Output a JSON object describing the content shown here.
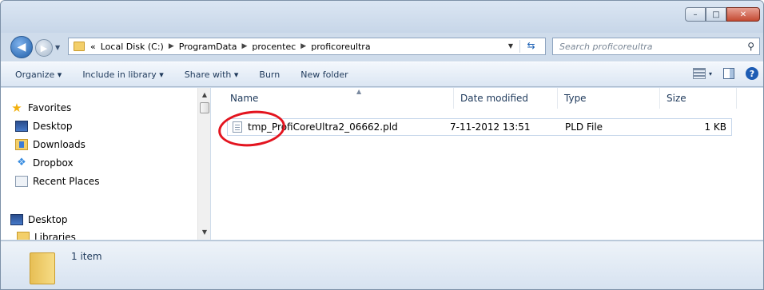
{
  "window": {
    "controls": {
      "minimize": "–",
      "maximize": "□",
      "close": "✕"
    }
  },
  "address": {
    "breadcrumb": [
      "«",
      "Local Disk (C:)",
      "ProgramData",
      "procentec",
      "proficoreultra"
    ],
    "search_placeholder": "Search proficoreultra"
  },
  "toolbar": {
    "organize": "Organize ▾",
    "include_in_library": "Include in library ▾",
    "share_with": "Share with ▾",
    "burn": "Burn",
    "new_folder": "New folder",
    "views": "▾"
  },
  "sidebar": {
    "items": [
      {
        "label": "Favorites",
        "icon": "star-icon"
      },
      {
        "label": "Desktop",
        "icon": "desktop-icon"
      },
      {
        "label": "Downloads",
        "icon": "downloads-icon"
      },
      {
        "label": "Dropbox",
        "icon": "dropbox-icon"
      },
      {
        "label": "Recent Places",
        "icon": "recent-places-icon"
      },
      {
        "label": "Desktop",
        "icon": "desktop-icon"
      },
      {
        "label": "Libraries",
        "icon": "libraries-icon"
      }
    ]
  },
  "columns": [
    "Name",
    "Date modified",
    "Type",
    "Size"
  ],
  "files": [
    {
      "name": "tmp_ProfiCoreUltra2_06662.pld",
      "date": "7-11-2012 13:51",
      "type": "PLD File",
      "size": "1 KB"
    }
  ],
  "status": {
    "item_count": "1 item"
  },
  "colors": {
    "highlight_circle": "#e3141f",
    "accent": "#1e395b"
  }
}
